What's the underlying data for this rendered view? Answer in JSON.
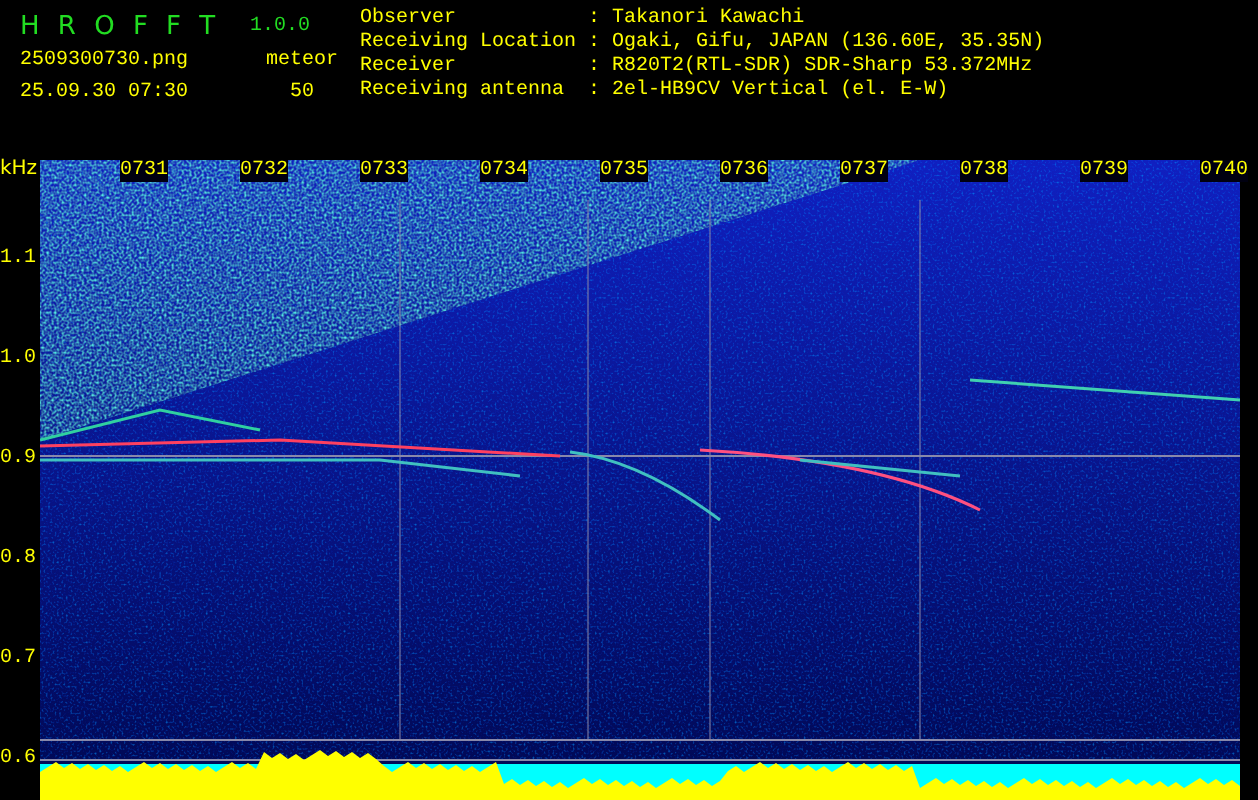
{
  "app": {
    "title": "H R O F F T",
    "version": "1.0.0"
  },
  "file": {
    "name": "2509300730.png",
    "timestamp": "25.09.30 07:30"
  },
  "counter": {
    "label": "meteor",
    "value": "50"
  },
  "station_info": [
    {
      "label": "Observer",
      "value": ": Takanori Kawachi"
    },
    {
      "label": "Receiving Location",
      "value": ": Ogaki, Gifu, JAPAN (136.60E, 35.35N)"
    },
    {
      "label": "Receiver",
      "value": ": R820T2(RTL-SDR) SDR-Sharp 53.372MHz"
    },
    {
      "label": "Receiving antenna",
      "value": ": 2el-HB9CV Vertical (el. E-W)"
    }
  ],
  "plot": {
    "y_unit": "kHz",
    "y_labels": [
      "1.1",
      "1.0",
      "0.9",
      "0.8",
      "0.7",
      "0.6"
    ],
    "x_labels": [
      "0731",
      "0732",
      "0733",
      "0734",
      "0735",
      "0736",
      "0737",
      "0738",
      "0739",
      "0740"
    ]
  }
}
